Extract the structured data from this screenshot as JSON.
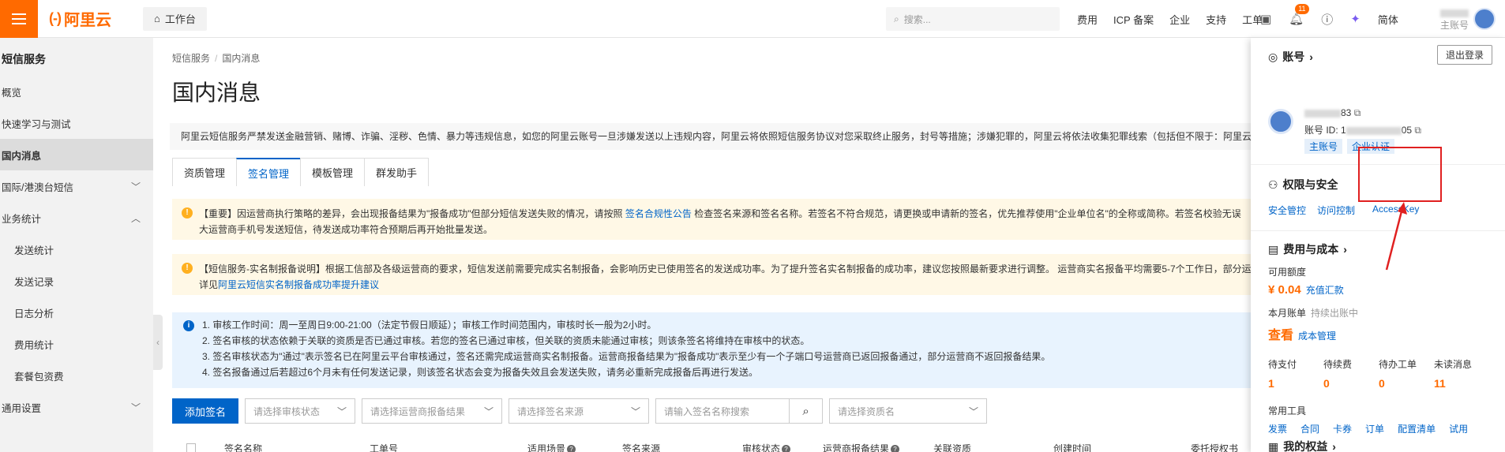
{
  "topbar": {
    "logo_text": "阿里云",
    "workbench_label": "工作台",
    "search_placeholder": "搜索...",
    "nav": [
      "费用",
      "ICP 备案",
      "企业",
      "支持",
      "工单"
    ],
    "notification_count": "11",
    "language_label": "简体",
    "user_role": "主账号",
    "brand_color": "#ff6a00"
  },
  "sidebar": {
    "title": "短信服务",
    "items": [
      {
        "label": "概览"
      },
      {
        "label": "快速学习与测试"
      },
      {
        "label": "国内消息"
      },
      {
        "label": "国际/港澳台短信"
      },
      {
        "label": "业务统计"
      },
      {
        "label": "发送统计"
      },
      {
        "label": "发送记录"
      },
      {
        "label": "日志分析"
      },
      {
        "label": "费用统计"
      },
      {
        "label": "套餐包资费"
      },
      {
        "label": "通用设置"
      }
    ]
  },
  "main": {
    "breadcrumb": [
      "短信服务",
      "国内消息"
    ],
    "title": "国内消息",
    "notice": "阿里云短信服务严禁发送金融营销、赌博、诈骗、淫秽、色情、暴力等违规信息，如您的阿里云账号一旦涉嫌发送以上违规内容，阿里云将依照短信服务协议对您采取终止服务，封号等措施；涉嫌犯罪的，阿里云将依法收集犯罪线索（包括但不限于：阿里云",
    "tabs": [
      "资质管理",
      "签名管理",
      "模板管理",
      "群发助手"
    ],
    "alert1": {
      "text_a": "【重要】因运营商执行策略的差异，会出现报备结果为\"报备成功\"但部分短信发送失败的情况，请按照",
      "link": "签名合规性公告",
      "text_b": "检查签名来源和签名名称。若签名不符合规范，请更换或申请新的签名，优先推荐使用\"企业单位名\"的全称或简称。若签名校验无误",
      "line2": "大运营商手机号发送短信，待发送成功率符合预期后再开始批量发送。"
    },
    "alert2": {
      "text_a": "【短信服务-实名制报备说明】根据工信部及各级运营商的要求，短信发送前需要完成实名制报备，会影响历史已使用签名的发送成功率。为了提升签名实名制报备的成功率，建议您按照最新要求进行调整。 运营商实名报备平均需要5-7个工作日，部分运",
      "line2_a": "详见",
      "link": "阿里云短信实名制报备成功率提升建议"
    },
    "info_lines": [
      "1. 审核工作时间：周一至周日9:00-21:00（法定节假日顺延）；审核工作时间范围内，审核时长一般为2小时。",
      "2. 签名审核的状态依赖于关联的资质是否已通过审核。若您的签名已通过审核，但关联的资质未能通过审核；则该条签名将维持在审核中的状态。",
      "3. 签名审核状态为\"通过\"表示签名已在阿里云平台审核通过，签名还需完成运营商实名制报备。运营商报备结果为\"报备成功\"表示至少有一个子端口号运营商已返回报备通过，部分运营商不返回报备结果。",
      "4. 签名报备通过后若超过6个月未有任何发送记录，则该签名状态会变为报备失效且会发送失败，请务必重新完成报备后再进行发送。"
    ],
    "add_button": "添加签名",
    "filters": [
      "请选择审核状态",
      "请选择运营商报备结果",
      "请选择签名来源"
    ],
    "search_placeholder": "请输入签名名称搜索",
    "qualification_filter": "请选择资质名",
    "columns": [
      "签名名称",
      "工单号",
      "适用场景",
      "签名来源",
      "审核状态",
      "运营商报备结果",
      "关联资质",
      "创建时间",
      "委托授权书"
    ]
  },
  "panel": {
    "account_title": "账号",
    "logout": "退出登录",
    "account_id_label": "账号 ID: 1",
    "account_id_suffix": "05",
    "account_name_suffix": "83",
    "tags": [
      "主账号",
      "企业认证"
    ],
    "security_title": "权限与安全",
    "security_links": [
      "安全管控",
      "访问控制",
      "AccessKey"
    ],
    "cost_title": "费用与成本",
    "balance_label": "可用额度",
    "balance_value": "¥ 0.04",
    "recharge": "充值汇款",
    "bill_label": "本月账单",
    "bill_status": "持续出账中",
    "view_label": "查看",
    "cost_mgmt": "成本管理",
    "stats": [
      {
        "label": "待支付",
        "value": "1"
      },
      {
        "label": "待续费",
        "value": "0"
      },
      {
        "label": "待办工单",
        "value": "0"
      },
      {
        "label": "未读消息",
        "value": "11"
      }
    ],
    "tools_label": "常用工具",
    "tools": [
      "发票",
      "合同",
      "卡券",
      "订单",
      "配置清单",
      "试用"
    ],
    "rights_title": "我的权益",
    "annotation_color": "#e02020"
  }
}
